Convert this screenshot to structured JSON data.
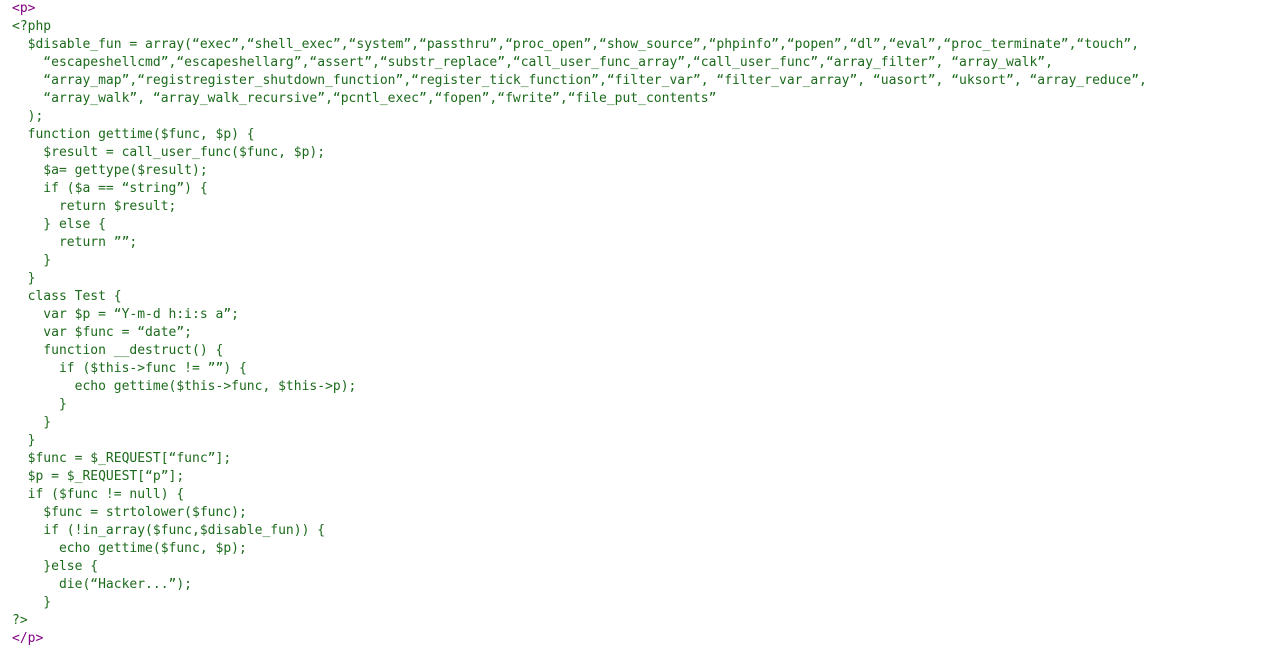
{
  "page": {
    "background_color": "#ffffff",
    "text_color_code": "#1c6b1c",
    "text_color_tag": "#800080",
    "font_size_px": 13,
    "line_height_px": 18
  },
  "document": {
    "open_paragraph_tag": "<p>",
    "close_paragraph_tag": "</p>",
    "php_open_tag": "<?php",
    "php_close_tag": "?>"
  },
  "code": {
    "lines": [
      "  $disable_fun = array(“exec”,“shell_exec”,“system”,“passthru”,“proc_open”,“show_source”,“phpinfo”,“popen”,“dl”,“eval”,“proc_terminate”,“touch”,",
      "    “escapeshellcmd”,“escapeshellarg”,“assert”,“substr_replace”,“call_user_func_array”,“call_user_func”,“array_filter”, “array_walk”,",
      "    “array_map”,“registregister_shutdown_function”,“register_tick_function”,“filter_var”, “filter_var_array”, “uasort”, “uksort”, “array_reduce”,",
      "    “array_walk”, “array_walk_recursive”,“pcntl_exec”,“fopen”,“fwrite”,“file_put_contents”",
      "  );",
      "  function gettime($func, $p) {",
      "    $result = call_user_func($func, $p);",
      "    $a= gettype($result);",
      "    if ($a == “string”) {",
      "      return $result;",
      "    } else {",
      "      return ””;",
      "    }",
      "  }",
      "  class Test {",
      "    var $p = “Y-m-d h:i:s a”;",
      "    var $func = “date”;",
      "    function __destruct() {",
      "      if ($this->func != ””) {",
      "        echo gettime($this->func, $this->p);",
      "      }",
      "    }",
      "  }",
      "  $func = $_REQUEST[“func”];",
      "  $p = $_REQUEST[“p”];",
      "  if ($func != null) {",
      "    $func = strtolower($func);",
      "    if (!in_array($func,$disable_fun)) {",
      "      echo gettime($func, $p);",
      "    }else {",
      "      die(“Hacker...”);",
      "    }",
      "  }"
    ]
  }
}
